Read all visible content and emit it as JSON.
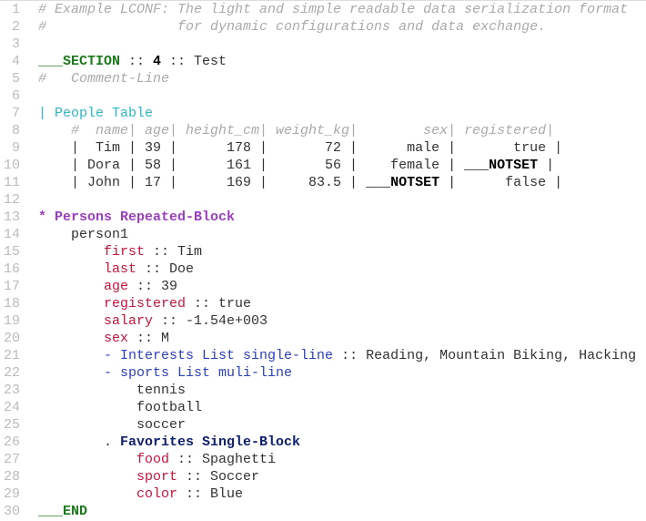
{
  "lines": [
    {
      "n": "1",
      "parts": [
        {
          "t": "# Example LCONF: The light and simple readable data serialization format",
          "c": "cm"
        }
      ]
    },
    {
      "n": "2",
      "parts": [
        {
          "t": "#                for dynamic configurations and data exchange.",
          "c": "cm"
        }
      ]
    },
    {
      "n": "3",
      "parts": []
    },
    {
      "n": "4",
      "parts": [
        {
          "t": "___SECTION",
          "c": "sec"
        },
        {
          "t": " :: ",
          "c": ""
        },
        {
          "t": "4",
          "c": "num"
        },
        {
          "t": " :: Test",
          "c": ""
        }
      ]
    },
    {
      "n": "5",
      "parts": [
        {
          "t": "#   Comment-Line",
          "c": "cm"
        }
      ]
    },
    {
      "n": "6",
      "parts": []
    },
    {
      "n": "7",
      "parts": [
        {
          "t": "| People Table",
          "c": "tbl"
        }
      ]
    },
    {
      "n": "8",
      "parts": [
        {
          "t": "    #  name| age| height_cm| weight_kg|        sex| registered|",
          "c": "cm"
        }
      ]
    },
    {
      "n": "9",
      "parts": [
        {
          "t": "    |  Tim | 39 |      178 |       72 |      male |       true |",
          "c": ""
        }
      ]
    },
    {
      "n": "10",
      "parts": [
        {
          "t": "    | Dora | 58 |      161 |       56 |    female | ",
          "c": ""
        },
        {
          "t": "___NOTSET",
          "c": "ns"
        },
        {
          "t": " |",
          "c": ""
        }
      ]
    },
    {
      "n": "11",
      "parts": [
        {
          "t": "    | John | 17 |      169 |     83.5 | ",
          "c": ""
        },
        {
          "t": "___NOTSET",
          "c": "ns"
        },
        {
          "t": " |      false |",
          "c": ""
        }
      ]
    },
    {
      "n": "12",
      "parts": []
    },
    {
      "n": "13",
      "parts": [
        {
          "t": "* Persons Repeated-Block",
          "c": "rep"
        }
      ]
    },
    {
      "n": "14",
      "parts": [
        {
          "t": "    person1",
          "c": ""
        }
      ]
    },
    {
      "n": "15",
      "parts": [
        {
          "t": "        ",
          "c": ""
        },
        {
          "t": "first",
          "c": "key"
        },
        {
          "t": " :: Tim",
          "c": ""
        }
      ]
    },
    {
      "n": "16",
      "parts": [
        {
          "t": "        ",
          "c": ""
        },
        {
          "t": "last",
          "c": "key"
        },
        {
          "t": " :: Doe",
          "c": ""
        }
      ]
    },
    {
      "n": "17",
      "parts": [
        {
          "t": "        ",
          "c": ""
        },
        {
          "t": "age",
          "c": "key"
        },
        {
          "t": " :: 39",
          "c": ""
        }
      ]
    },
    {
      "n": "18",
      "parts": [
        {
          "t": "        ",
          "c": ""
        },
        {
          "t": "registered",
          "c": "key"
        },
        {
          "t": " :: true",
          "c": ""
        }
      ]
    },
    {
      "n": "19",
      "parts": [
        {
          "t": "        ",
          "c": ""
        },
        {
          "t": "salary",
          "c": "key"
        },
        {
          "t": " :: -1.54e+003",
          "c": ""
        }
      ]
    },
    {
      "n": "20",
      "parts": [
        {
          "t": "        ",
          "c": ""
        },
        {
          "t": "sex",
          "c": "key"
        },
        {
          "t": " :: M",
          "c": ""
        }
      ]
    },
    {
      "n": "21",
      "parts": [
        {
          "t": "        ",
          "c": ""
        },
        {
          "t": "- Interests List single-line",
          "c": "lst"
        },
        {
          "t": " :: Reading, Mountain Biking, Hacking",
          "c": ""
        }
      ]
    },
    {
      "n": "22",
      "parts": [
        {
          "t": "        ",
          "c": ""
        },
        {
          "t": "- sports List muli-line",
          "c": "lst"
        }
      ]
    },
    {
      "n": "23",
      "parts": [
        {
          "t": "            tennis",
          "c": ""
        }
      ]
    },
    {
      "n": "24",
      "parts": [
        {
          "t": "            football",
          "c": ""
        }
      ]
    },
    {
      "n": "25",
      "parts": [
        {
          "t": "            soccer",
          "c": ""
        }
      ]
    },
    {
      "n": "26",
      "parts": [
        {
          "t": "        . ",
          "c": ""
        },
        {
          "t": "Favorites Single-Block",
          "c": "blk"
        }
      ]
    },
    {
      "n": "27",
      "parts": [
        {
          "t": "            ",
          "c": ""
        },
        {
          "t": "food",
          "c": "key"
        },
        {
          "t": " :: Spaghetti",
          "c": ""
        }
      ]
    },
    {
      "n": "28",
      "parts": [
        {
          "t": "            ",
          "c": ""
        },
        {
          "t": "sport",
          "c": "key"
        },
        {
          "t": " :: Soccer",
          "c": ""
        }
      ]
    },
    {
      "n": "29",
      "parts": [
        {
          "t": "            ",
          "c": ""
        },
        {
          "t": "color",
          "c": "key"
        },
        {
          "t": " :: Blue",
          "c": ""
        }
      ]
    },
    {
      "n": "30",
      "parts": [
        {
          "t": "___END",
          "c": "sec"
        }
      ]
    }
  ]
}
